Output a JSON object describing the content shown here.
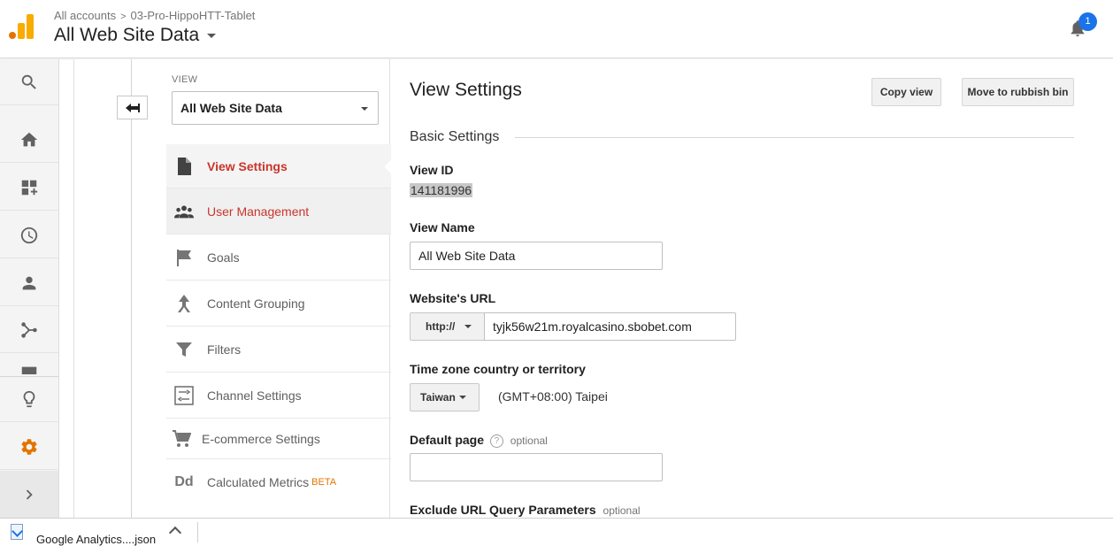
{
  "header": {
    "breadcrumb_root": "All accounts",
    "breadcrumb_sep": ">",
    "breadcrumb_account": "03-Pro-HippoHTT-Tablet",
    "view_title": "All Web Site Data",
    "notification_count": "1"
  },
  "rail": {
    "items": [
      "search-icon",
      "home-icon",
      "customization-icon",
      "realtime-clock-icon",
      "audience-person-icon",
      "acquisition-icon",
      "behavior-icon",
      "discover-lightbulb-icon",
      "admin-gear-icon",
      "expand-chevron-icon"
    ]
  },
  "admin": {
    "view_label": "VIEW",
    "view_selected": "All Web Site Data",
    "menu": [
      {
        "label": "View Settings",
        "icon": "document-icon"
      },
      {
        "label": "User Management",
        "icon": "people-icon"
      },
      {
        "label": "Goals",
        "icon": "flag-icon"
      },
      {
        "label": "Content Grouping",
        "icon": "grouping-icon"
      },
      {
        "label": "Filters",
        "icon": "filter-icon"
      },
      {
        "label": "Channel Settings",
        "icon": "channel-icon"
      },
      {
        "label": "E-commerce Settings",
        "icon": "cart-icon"
      },
      {
        "label": "Calculated Metrics",
        "icon": "dd-icon",
        "badge": "BETA"
      }
    ]
  },
  "settings": {
    "title": "View Settings",
    "copy_view": "Copy view",
    "move_to_rubbish": "Move to rubbish bin",
    "section_basic": "Basic Settings",
    "view_id_label": "View ID",
    "view_id_value": "141181996",
    "view_name_label": "View Name",
    "view_name_value": "All Web Site Data",
    "website_url_label": "Website's URL",
    "protocol_value": "http://",
    "url_value": "tyjk56w21m.royalcasino.sbobet.com",
    "timezone_label": "Time zone country or territory",
    "timezone_country": "Taiwan",
    "timezone_value": "(GMT+08:00) Taipei",
    "default_page_label": "Default page",
    "default_page_optional": "optional",
    "default_page_value": "",
    "help_glyph": "?",
    "exclude_label": "Exclude URL Query Parameters",
    "exclude_optional": "optional"
  },
  "downloads": {
    "file_name": "Google Analytics....json"
  },
  "colors": {
    "accent_red": "#c8362b",
    "badge_blue": "#1a73e8",
    "logo_orange": "#f9ab00",
    "admin_orange": "#e37400"
  }
}
